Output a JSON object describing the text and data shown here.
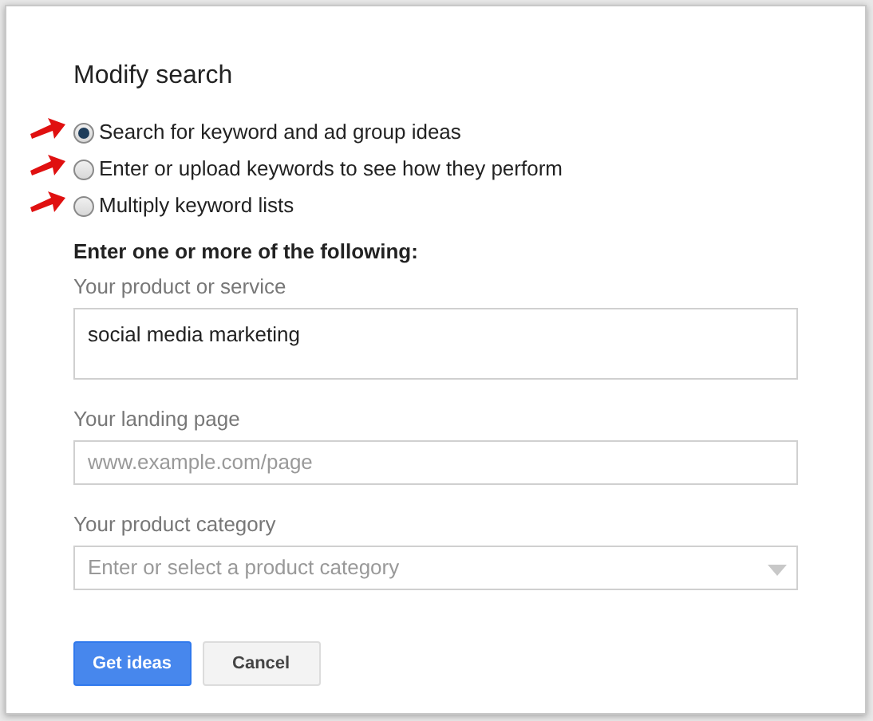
{
  "dialog": {
    "title": "Modify search",
    "options": [
      {
        "label": "Search for keyword and ad group ideas",
        "selected": true,
        "pointer_arrow": true
      },
      {
        "label": "Enter or upload keywords to see how they perform",
        "selected": false,
        "pointer_arrow": true
      },
      {
        "label": "Multiply keyword lists",
        "selected": false,
        "pointer_arrow": true
      }
    ],
    "section_heading": "Enter one or more of the following:",
    "fields": [
      {
        "kind": "textarea",
        "label": "Your product or service",
        "value": "social media marketing"
      },
      {
        "kind": "input",
        "label": "Your landing page",
        "placeholder": "www.example.com/page"
      },
      {
        "kind": "dropdown",
        "label": "Your product category",
        "placeholder": "Enter or select a product category"
      }
    ],
    "buttons": [
      {
        "label": "Get ideas",
        "kind": "primary"
      },
      {
        "label": "Cancel",
        "kind": "secondary"
      }
    ]
  }
}
